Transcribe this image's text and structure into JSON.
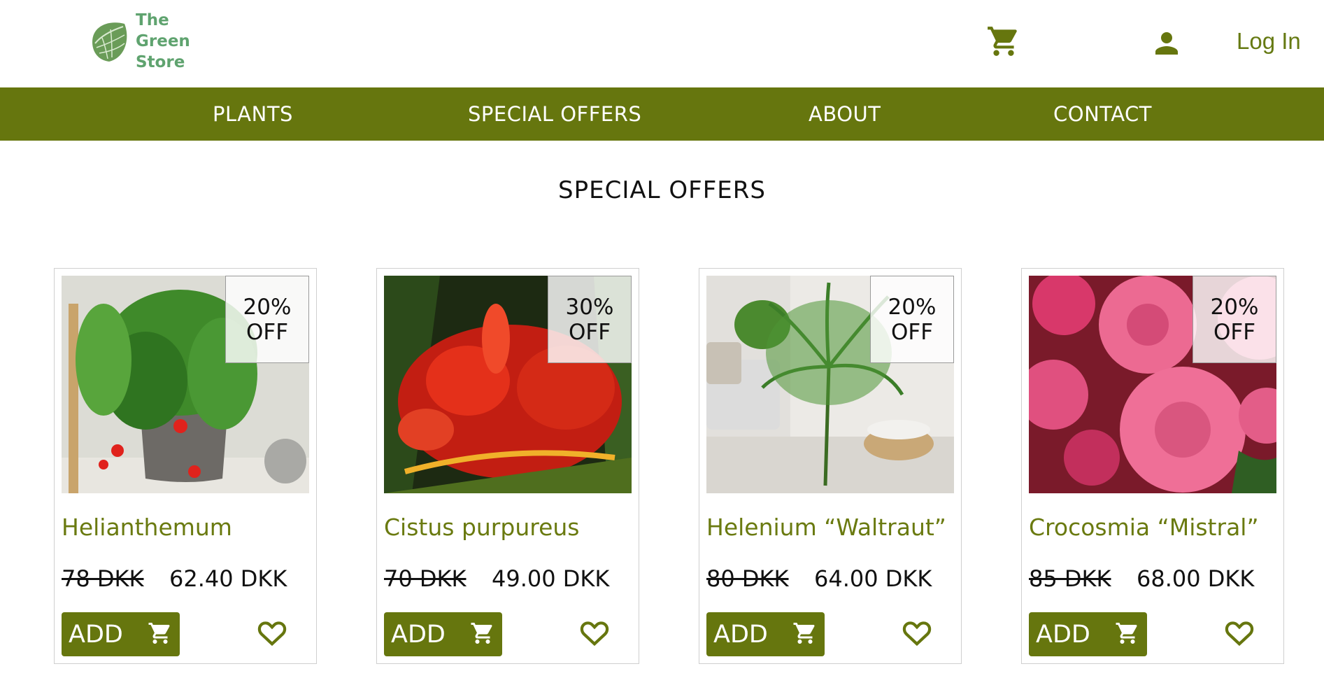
{
  "header": {
    "logo_lines": [
      "The",
      "Green",
      "Store"
    ],
    "login_label": "Log In"
  },
  "nav": {
    "items": [
      "PLANTS",
      "SPECIAL OFFERS",
      "ABOUT",
      "CONTACT"
    ]
  },
  "page": {
    "title": "SPECIAL OFFERS"
  },
  "products": [
    {
      "name": "Helianthemum",
      "old_price": "78 DKK",
      "new_price": "62.40 DKK",
      "discount_pct": "20%",
      "discount_word": "OFF",
      "add_label": "ADD"
    },
    {
      "name": "Cistus purpureus",
      "old_price": "70 DKK",
      "new_price": "49.00 DKK",
      "discount_pct": "30%",
      "discount_word": "OFF",
      "add_label": "ADD"
    },
    {
      "name": "Helenium “Waltraut”",
      "old_price": "80 DKK",
      "new_price": "64.00 DKK",
      "discount_pct": "20%",
      "discount_word": "OFF",
      "add_label": "ADD"
    },
    {
      "name": "Crocosmia “Mistral”",
      "old_price": "85 DKK",
      "new_price": "68.00 DKK",
      "discount_pct": "20%",
      "discount_word": "OFF",
      "add_label": "ADD"
    }
  ],
  "colors": {
    "brand_green": "#66760e",
    "logo_green": "#5fa36f",
    "text_dark": "#111111"
  },
  "icons": {
    "cart": "cart-icon",
    "user": "user-icon",
    "favorite": "heart-icon",
    "logo": "leaf-icon"
  }
}
